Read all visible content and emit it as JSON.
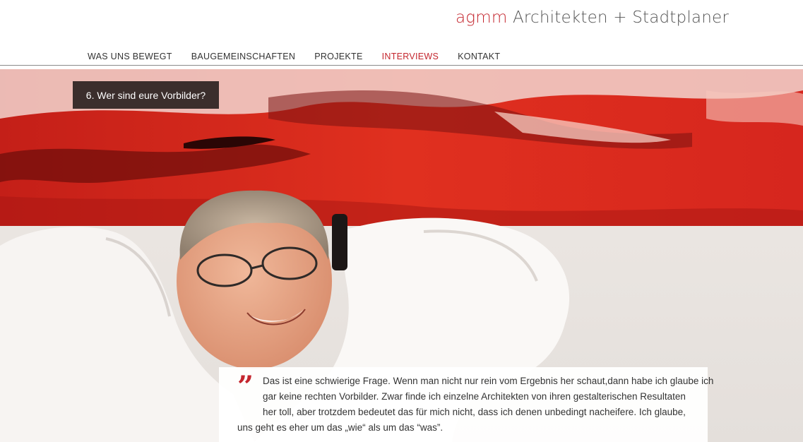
{
  "header": {
    "logo_brand": "agmm",
    "logo_rest": " Architekten + Stadtplaner"
  },
  "nav": {
    "items": [
      {
        "label": "WAS UNS BEWEGT",
        "active": false
      },
      {
        "label": "BAUGEMEINSCHAFTEN",
        "active": false
      },
      {
        "label": "PROJEKTE",
        "active": false
      },
      {
        "label": "INTERVIEWS",
        "active": true
      },
      {
        "label": "KONTAKT",
        "active": false
      }
    ]
  },
  "hero": {
    "image_alt": "Portrait eines lachenden Mannes vor einem roten Gemälde"
  },
  "question": {
    "label": "6. Wer sind eure Vorbilder?"
  },
  "quote": {
    "mark": "”",
    "lines": [
      "Das ist eine schwierige Frage. Wenn man nicht nur rein vom Ergebnis her schaut,dann habe ich glaube ich",
      "gar keine rechten Vorbilder. Zwar finde ich einzelne Architekten von ihren gestalterischen Resultaten",
      "her toll, aber trotzdem bedeutet das für mich nicht, dass ich denen unbedingt nacheifere. Ich glaube,",
      "uns geht es eher um das „wie“ als um das “was”."
    ]
  },
  "colors": {
    "accent": "#c4262e",
    "question_bg": "#3b2e2c",
    "painting_red": "#d8291f"
  }
}
